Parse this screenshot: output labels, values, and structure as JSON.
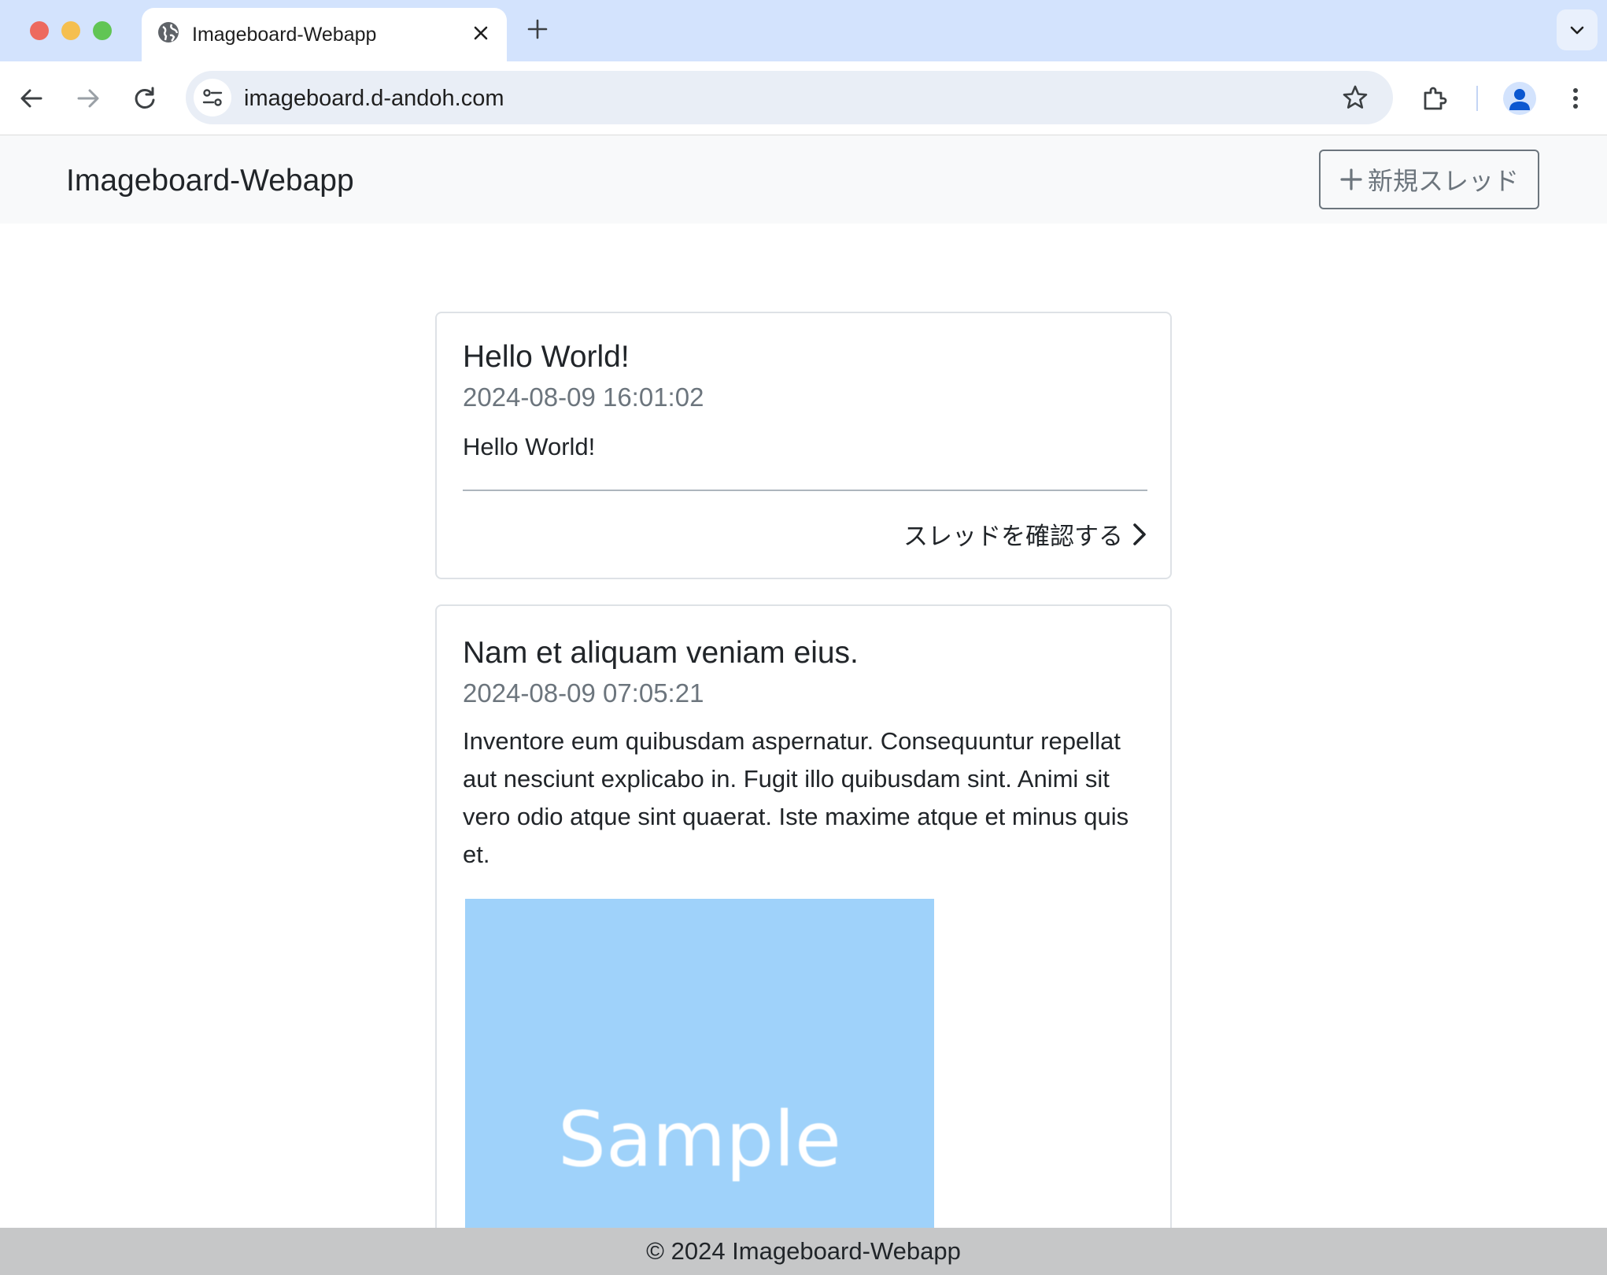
{
  "browser": {
    "tab_title": "Imageboard-Webapp",
    "url": "imageboard.d-andoh.com",
    "icons": {
      "favicon": "globe-icon",
      "close": "close-icon",
      "new_tab": "plus-icon",
      "tab_search": "chevron-down-icon",
      "back": "back-arrow-icon",
      "forward": "forward-arrow-icon",
      "reload": "reload-icon",
      "site_info": "tune-icon",
      "bookmark": "star-icon",
      "extensions": "puzzle-icon",
      "profile": "person-icon",
      "menu": "kebab-menu-icon"
    }
  },
  "navbar": {
    "brand": "Imageboard-Webapp",
    "new_thread_label": "新規スレッド",
    "new_thread_icon": "plus-icon"
  },
  "threads": [
    {
      "title": "Hello World!",
      "date": "2024-08-09 16:01:02",
      "body": "Hello World!",
      "link_label": "スレッドを確認する",
      "link_icon": "chevron-right-icon"
    },
    {
      "title": "Nam et aliquam veniam eius.",
      "date": "2024-08-09 07:05:21",
      "body": "Inventore eum quibusdam aspernatur. Consequuntur repellat aut nesciunt explicabo in. Fugit illo quibusdam sint. Animi sit vero odio atque sint quaerat. Iste maxime atque et minus quis et.",
      "image_text": "Sample"
    }
  ],
  "footer": {
    "text": "© 2024 Imageboard-Webapp"
  },
  "colors": {
    "tabstrip": "#d3e3fd",
    "navbar_bg": "#f8f9fa",
    "secondary": "#6c757d",
    "sample_image": "#9fd2fa",
    "footer_bg": "#c6c7c8"
  }
}
